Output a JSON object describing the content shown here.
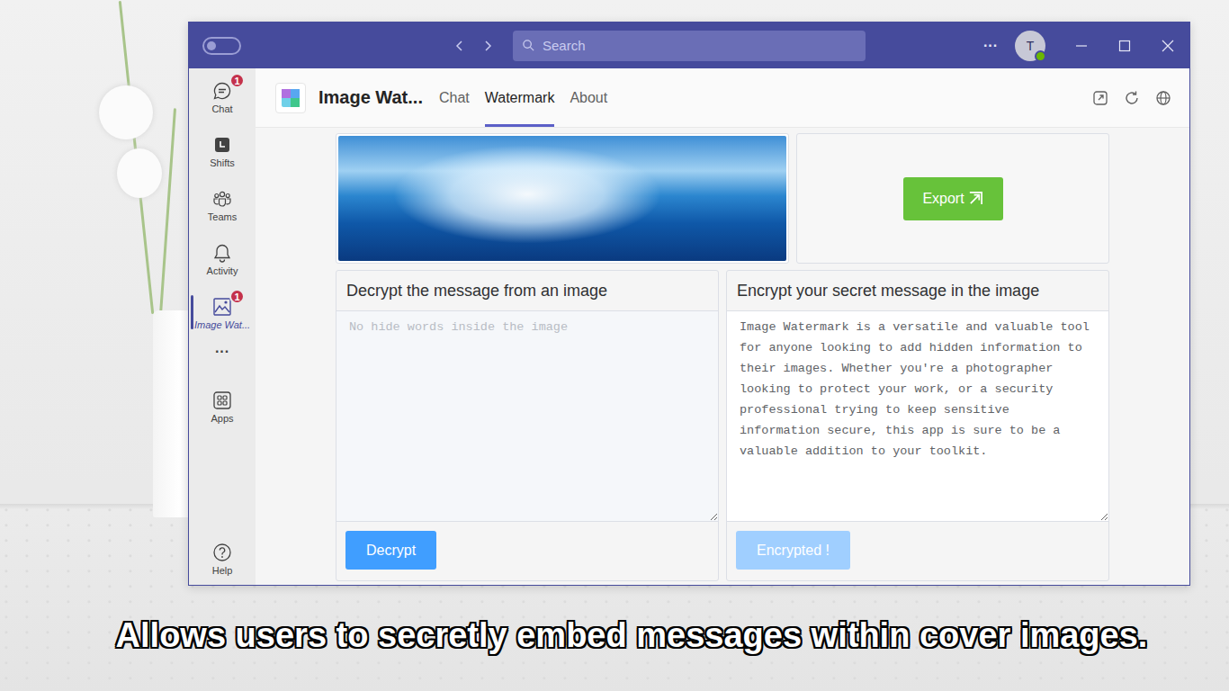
{
  "caption": "Allows users to secretly embed messages within cover images.",
  "titlebar": {
    "search_placeholder": "Search",
    "more": "···",
    "avatar": "T"
  },
  "rail": {
    "apps": [
      {
        "label": "Chat",
        "badge": "1",
        "selected": false
      },
      {
        "label": "Shifts",
        "badge": null,
        "selected": false
      },
      {
        "label": "Teams",
        "badge": null,
        "selected": false
      },
      {
        "label": "Activity",
        "badge": null,
        "selected": false
      },
      {
        "label": "Image Wat...",
        "badge": "1",
        "selected": true
      }
    ],
    "more": "···",
    "store": {
      "label": "Apps",
      "selected": false
    },
    "help": {
      "label": "Help",
      "selected": false
    }
  },
  "app": {
    "title": "Image Wat...",
    "tabs": [
      {
        "label": "Chat",
        "selected": false
      },
      {
        "label": "Watermark",
        "selected": true
      },
      {
        "label": "About",
        "selected": false
      }
    ]
  },
  "export_button": "Export",
  "decrypt": {
    "title": "Decrypt the message from an image",
    "placeholder": "No hide words inside the image",
    "value": "",
    "button": "Decrypt",
    "button_disabled": false
  },
  "encrypt": {
    "title": "Encrypt your secret message in the image",
    "value": "Image Watermark is a versatile and valuable tool for anyone looking to add hidden information to their images. Whether you're a photographer looking to protect your work, or a security professional trying to keep sensitive information secure, this app is sure to be a valuable addition to your toolkit.",
    "button": "Encrypted !",
    "button_disabled": true
  }
}
